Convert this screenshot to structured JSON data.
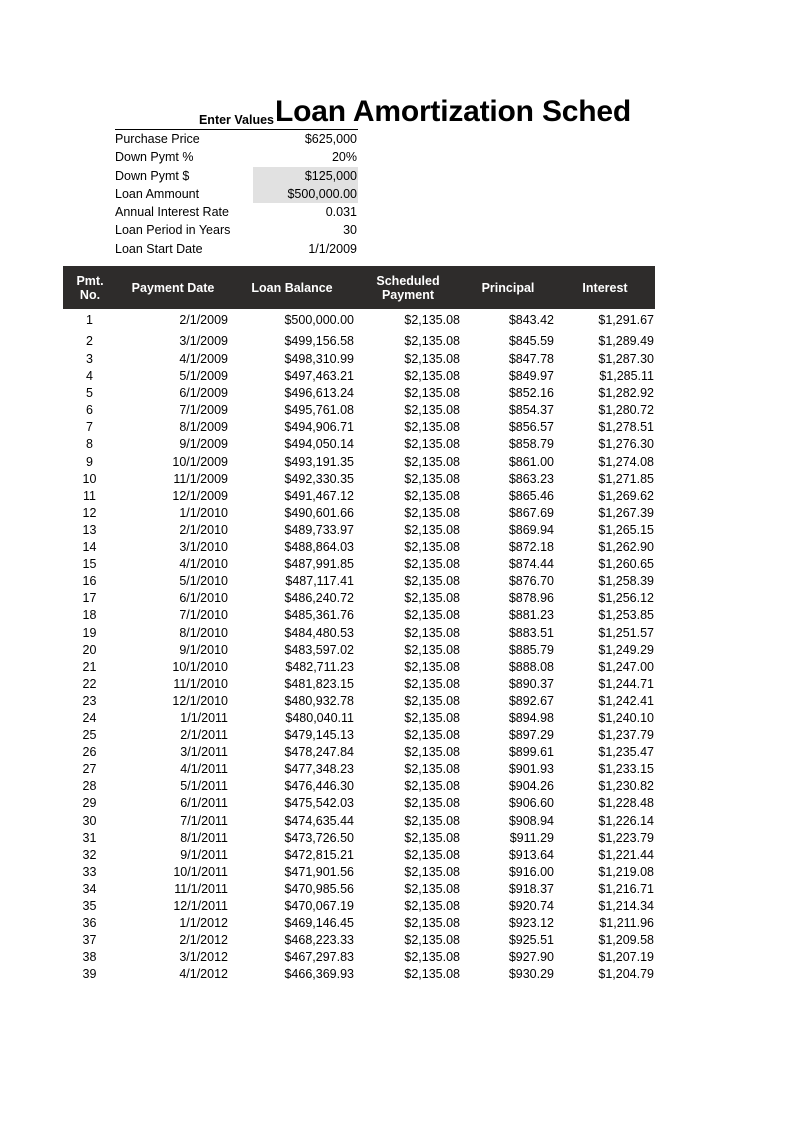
{
  "document": {
    "title": "Loan Amortization Sched"
  },
  "inputs": {
    "caption": "Enter Values",
    "rows": [
      {
        "label": "Purchase Price",
        "value": "$625,000",
        "shaded": false
      },
      {
        "label": "Down Pymt %",
        "value": "20%",
        "shaded": false
      },
      {
        "label": "Down Pymt $",
        "value": "$125,000",
        "shaded": true
      },
      {
        "label": "Loan Ammount",
        "value": "$500,000.00",
        "shaded": true
      },
      {
        "label": "Annual Interest Rate",
        "value": "0.031",
        "shaded": false
      },
      {
        "label": "Loan Period in Years",
        "value": "30",
        "shaded": false
      },
      {
        "label": "Loan Start Date",
        "value": "1/1/2009",
        "shaded": false
      }
    ]
  },
  "schedule": {
    "header_bg": "#2e2c2b",
    "header_fg": "#ffffff",
    "shaded_cell_bg": "#e1e1e1",
    "columns": [
      "Pmt. No.",
      "Payment Date",
      "Loan Balance",
      "Scheduled Payment",
      "Principal",
      "Interest"
    ],
    "columns_lines": [
      [
        "Pmt.",
        "No."
      ],
      [
        "Payment Date"
      ],
      [
        "Loan Balance"
      ],
      [
        "Scheduled",
        "Payment"
      ],
      [
        "Principal"
      ],
      [
        "Interest"
      ]
    ],
    "rows": [
      [
        "1",
        "2/1/2009",
        "$500,000.00",
        "$2,135.08",
        "$843.42",
        "$1,291.67"
      ],
      [
        "2",
        "3/1/2009",
        "$499,156.58",
        "$2,135.08",
        "$845.59",
        "$1,289.49"
      ],
      [
        "3",
        "4/1/2009",
        "$498,310.99",
        "$2,135.08",
        "$847.78",
        "$1,287.30"
      ],
      [
        "4",
        "5/1/2009",
        "$497,463.21",
        "$2,135.08",
        "$849.97",
        "$1,285.11"
      ],
      [
        "5",
        "6/1/2009",
        "$496,613.24",
        "$2,135.08",
        "$852.16",
        "$1,282.92"
      ],
      [
        "6",
        "7/1/2009",
        "$495,761.08",
        "$2,135.08",
        "$854.37",
        "$1,280.72"
      ],
      [
        "7",
        "8/1/2009",
        "$494,906.71",
        "$2,135.08",
        "$856.57",
        "$1,278.51"
      ],
      [
        "8",
        "9/1/2009",
        "$494,050.14",
        "$2,135.08",
        "$858.79",
        "$1,276.30"
      ],
      [
        "9",
        "10/1/2009",
        "$493,191.35",
        "$2,135.08",
        "$861.00",
        "$1,274.08"
      ],
      [
        "10",
        "11/1/2009",
        "$492,330.35",
        "$2,135.08",
        "$863.23",
        "$1,271.85"
      ],
      [
        "11",
        "12/1/2009",
        "$491,467.12",
        "$2,135.08",
        "$865.46",
        "$1,269.62"
      ],
      [
        "12",
        "1/1/2010",
        "$490,601.66",
        "$2,135.08",
        "$867.69",
        "$1,267.39"
      ],
      [
        "13",
        "2/1/2010",
        "$489,733.97",
        "$2,135.08",
        "$869.94",
        "$1,265.15"
      ],
      [
        "14",
        "3/1/2010",
        "$488,864.03",
        "$2,135.08",
        "$872.18",
        "$1,262.90"
      ],
      [
        "15",
        "4/1/2010",
        "$487,991.85",
        "$2,135.08",
        "$874.44",
        "$1,260.65"
      ],
      [
        "16",
        "5/1/2010",
        "$487,117.41",
        "$2,135.08",
        "$876.70",
        "$1,258.39"
      ],
      [
        "17",
        "6/1/2010",
        "$486,240.72",
        "$2,135.08",
        "$878.96",
        "$1,256.12"
      ],
      [
        "18",
        "7/1/2010",
        "$485,361.76",
        "$2,135.08",
        "$881.23",
        "$1,253.85"
      ],
      [
        "19",
        "8/1/2010",
        "$484,480.53",
        "$2,135.08",
        "$883.51",
        "$1,251.57"
      ],
      [
        "20",
        "9/1/2010",
        "$483,597.02",
        "$2,135.08",
        "$885.79",
        "$1,249.29"
      ],
      [
        "21",
        "10/1/2010",
        "$482,711.23",
        "$2,135.08",
        "$888.08",
        "$1,247.00"
      ],
      [
        "22",
        "11/1/2010",
        "$481,823.15",
        "$2,135.08",
        "$890.37",
        "$1,244.71"
      ],
      [
        "23",
        "12/1/2010",
        "$480,932.78",
        "$2,135.08",
        "$892.67",
        "$1,242.41"
      ],
      [
        "24",
        "1/1/2011",
        "$480,040.11",
        "$2,135.08",
        "$894.98",
        "$1,240.10"
      ],
      [
        "25",
        "2/1/2011",
        "$479,145.13",
        "$2,135.08",
        "$897.29",
        "$1,237.79"
      ],
      [
        "26",
        "3/1/2011",
        "$478,247.84",
        "$2,135.08",
        "$899.61",
        "$1,235.47"
      ],
      [
        "27",
        "4/1/2011",
        "$477,348.23",
        "$2,135.08",
        "$901.93",
        "$1,233.15"
      ],
      [
        "28",
        "5/1/2011",
        "$476,446.30",
        "$2,135.08",
        "$904.26",
        "$1,230.82"
      ],
      [
        "29",
        "6/1/2011",
        "$475,542.03",
        "$2,135.08",
        "$906.60",
        "$1,228.48"
      ],
      [
        "30",
        "7/1/2011",
        "$474,635.44",
        "$2,135.08",
        "$908.94",
        "$1,226.14"
      ],
      [
        "31",
        "8/1/2011",
        "$473,726.50",
        "$2,135.08",
        "$911.29",
        "$1,223.79"
      ],
      [
        "32",
        "9/1/2011",
        "$472,815.21",
        "$2,135.08",
        "$913.64",
        "$1,221.44"
      ],
      [
        "33",
        "10/1/2011",
        "$471,901.56",
        "$2,135.08",
        "$916.00",
        "$1,219.08"
      ],
      [
        "34",
        "11/1/2011",
        "$470,985.56",
        "$2,135.08",
        "$918.37",
        "$1,216.71"
      ],
      [
        "35",
        "12/1/2011",
        "$470,067.19",
        "$2,135.08",
        "$920.74",
        "$1,214.34"
      ],
      [
        "36",
        "1/1/2012",
        "$469,146.45",
        "$2,135.08",
        "$923.12",
        "$1,211.96"
      ],
      [
        "37",
        "2/1/2012",
        "$468,223.33",
        "$2,135.08",
        "$925.51",
        "$1,209.58"
      ],
      [
        "38",
        "3/1/2012",
        "$467,297.83",
        "$2,135.08",
        "$927.90",
        "$1,207.19"
      ],
      [
        "39",
        "4/1/2012",
        "$466,369.93",
        "$2,135.08",
        "$930.29",
        "$1,204.79"
      ]
    ]
  }
}
